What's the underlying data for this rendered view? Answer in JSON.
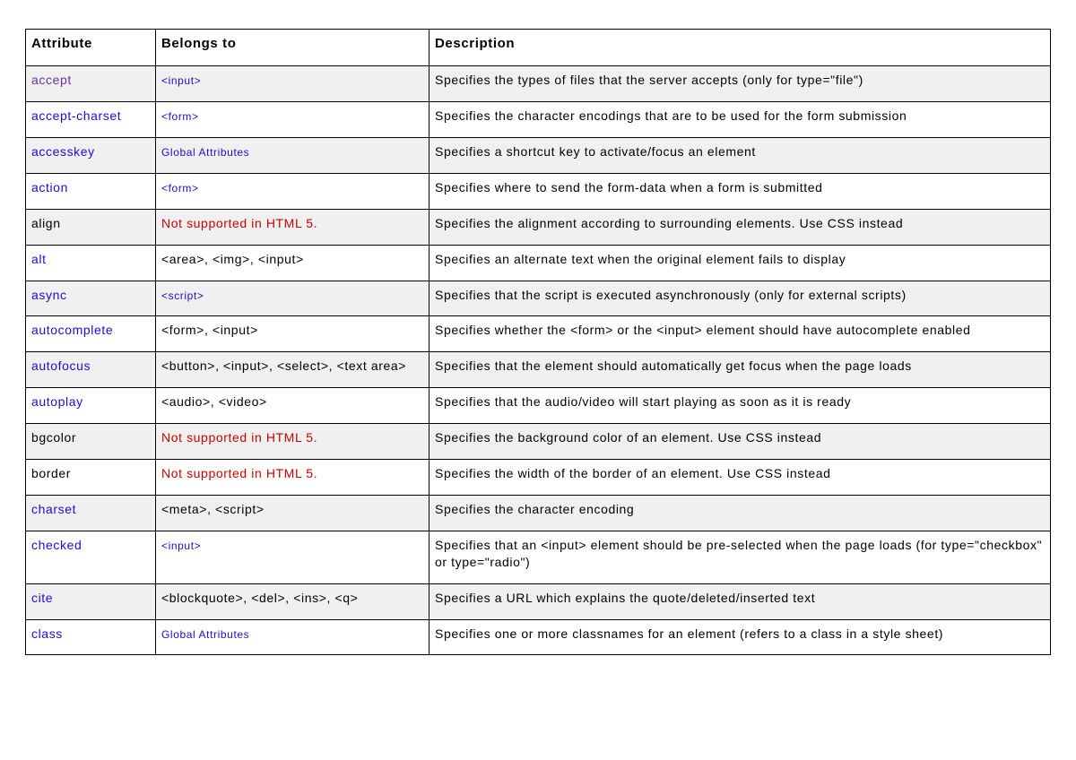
{
  "headers": {
    "attribute": "Attribute",
    "belongs_to": "Belongs to",
    "description": "Description"
  },
  "rows": [
    {
      "attribute": {
        "text": "accept",
        "style": "visited"
      },
      "belongs": {
        "text": "<input>",
        "style": "blue-small"
      },
      "desc": "Specifies the types of files that the server accepts (only for type=\"file\")"
    },
    {
      "attribute": {
        "text": "accept-charset",
        "style": "blue"
      },
      "belongs": {
        "text": "<form>",
        "style": "blue-small"
      },
      "desc": "Specifies the character encodings that are to be used for the form submission"
    },
    {
      "attribute": {
        "text": "accesskey",
        "style": "blue"
      },
      "belongs": {
        "text": "Global Attributes",
        "style": "blue-small"
      },
      "desc": "Specifies a shortcut key to activate/focus an element"
    },
    {
      "attribute": {
        "text": "action",
        "style": "blue"
      },
      "belongs": {
        "text": "<form>",
        "style": "blue-small"
      },
      "desc": "Specifies where to send the form-data when a form is submitted"
    },
    {
      "attribute": {
        "text": "align",
        "style": "black"
      },
      "belongs": {
        "text": "Not supported in HTML 5.",
        "style": "red"
      },
      "desc": "Specifies the alignment according to surrounding elements. Use CSS instead"
    },
    {
      "attribute": {
        "text": "alt",
        "style": "blue"
      },
      "belongs": {
        "text": "<area>, <img>, <input>",
        "style": "black"
      },
      "desc": "Specifies an alternate text when the original element fails to display"
    },
    {
      "attribute": {
        "text": "async",
        "style": "blue"
      },
      "belongs": {
        "text": "<script>",
        "style": "blue-small"
      },
      "desc": "Specifies that the script is executed asynchronously (only for external scripts)"
    },
    {
      "attribute": {
        "text": "autocomplete",
        "style": "blue"
      },
      "belongs": {
        "text": "<form>, <input>",
        "style": "black"
      },
      "desc": "Specifies whether the <form> or the <input> element should have autocomplete enabled"
    },
    {
      "attribute": {
        "text": "autofocus",
        "style": "blue"
      },
      "belongs": {
        "text": "<button>, <input>, <select>, <text area>",
        "style": "black"
      },
      "desc": "Specifies that the element should automatically get focus when the page loads"
    },
    {
      "attribute": {
        "text": "autoplay",
        "style": "blue"
      },
      "belongs": {
        "text": "<audio>, <video>",
        "style": "black"
      },
      "desc": "Specifies that the audio/video will start playing as soon as it is ready"
    },
    {
      "attribute": {
        "text": "bgcolor",
        "style": "black"
      },
      "belongs": {
        "text": "Not supported in HTML 5.",
        "style": "red"
      },
      "desc": "Specifies the background color of an element. Use CSS instead"
    },
    {
      "attribute": {
        "text": "border",
        "style": "black"
      },
      "belongs": {
        "text": "Not supported in HTML 5.",
        "style": "red"
      },
      "desc": "Specifies the width of the border of an element. Use CSS instead"
    },
    {
      "attribute": {
        "text": "charset",
        "style": "blue"
      },
      "belongs": {
        "text": "<meta>, <script>",
        "style": "black"
      },
      "desc": "Specifies the character encoding"
    },
    {
      "attribute": {
        "text": "checked",
        "style": "blue"
      },
      "belongs": {
        "text": "<input>",
        "style": "blue-small"
      },
      "desc": "Specifies that an <input> element should be pre-selected when the page loads (for type=\"checkbox\" or type=\"radio\")"
    },
    {
      "attribute": {
        "text": "cite",
        "style": "blue"
      },
      "belongs": {
        "text": "<blockquote>, <del>, <ins>, <q>",
        "style": "black"
      },
      "desc": "Specifies a URL which explains the quote/deleted/inserted text"
    },
    {
      "attribute": {
        "text": "class",
        "style": "blue"
      },
      "belongs": {
        "text": "Global Attributes",
        "style": "blue-small"
      },
      "desc": "Specifies one or more classnames for an element (refers to a class in a style sheet)"
    }
  ]
}
